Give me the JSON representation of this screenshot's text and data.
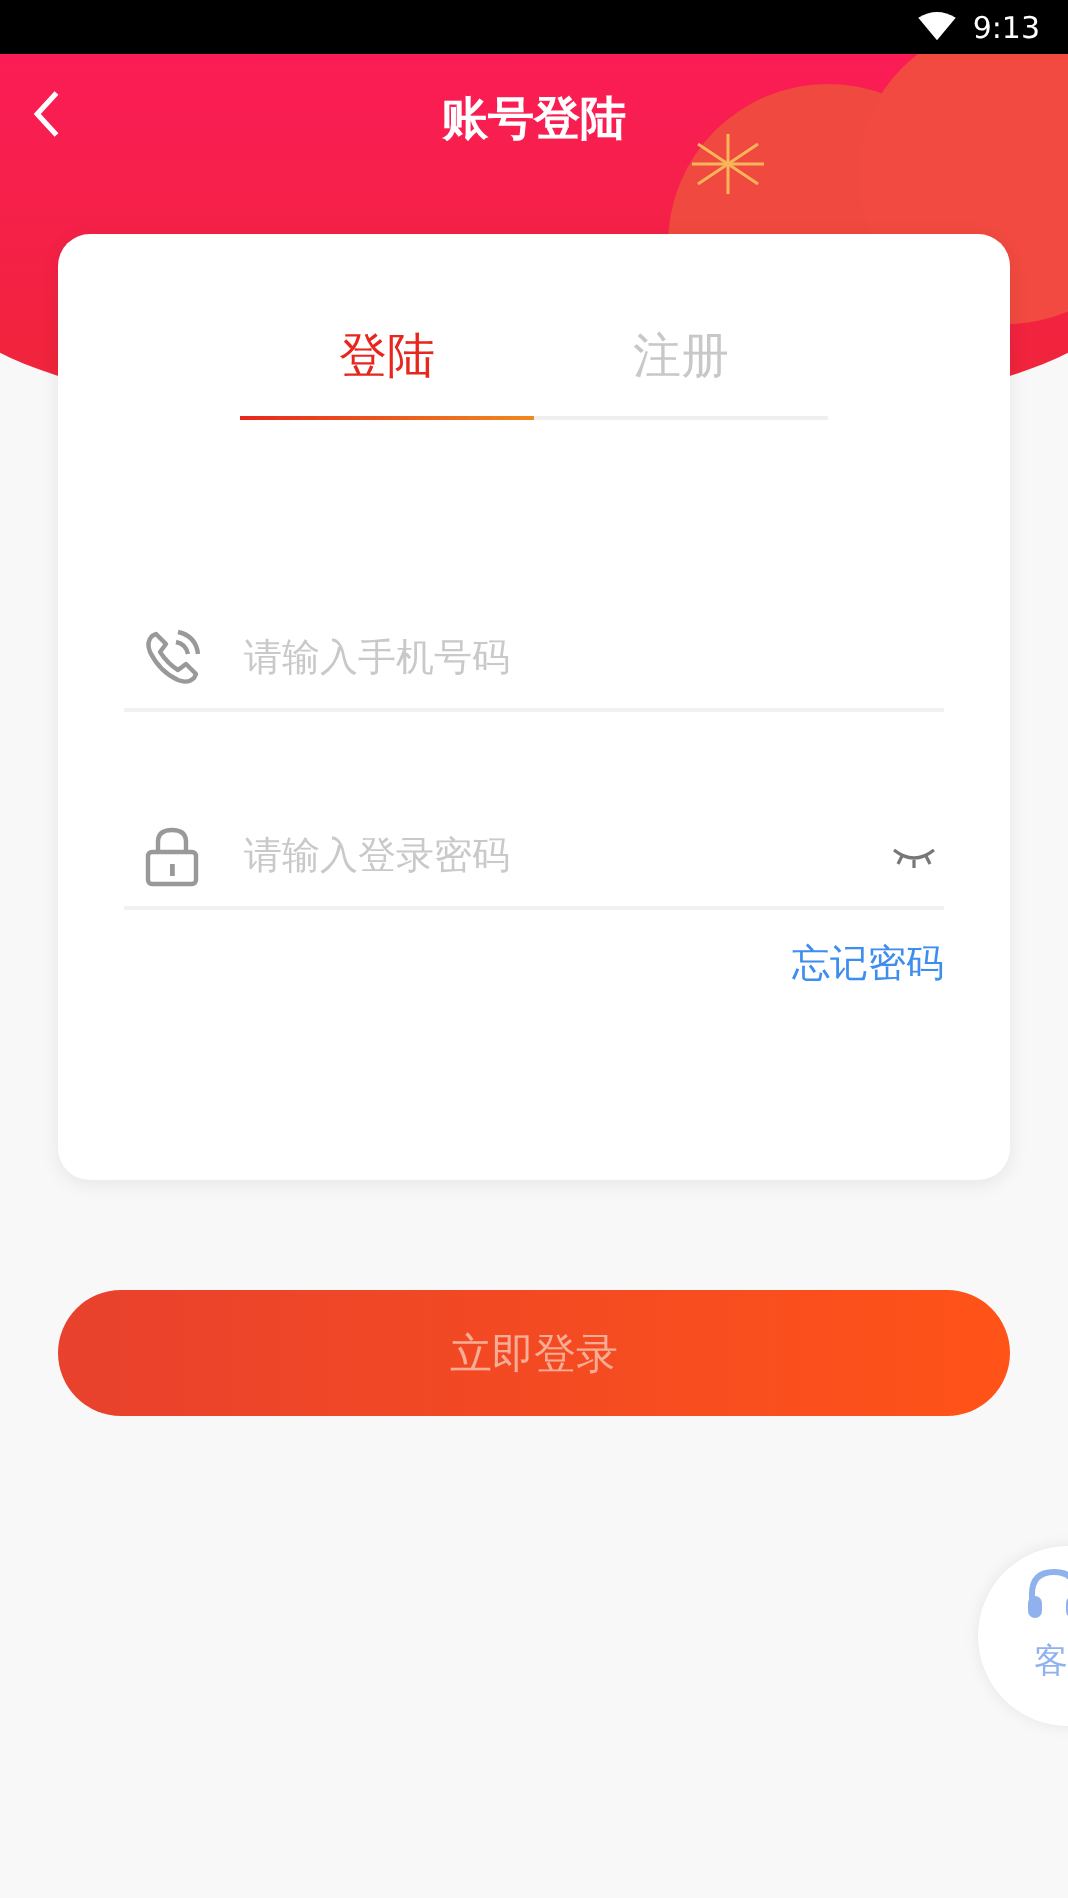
{
  "status_bar": {
    "time": "9:13"
  },
  "header": {
    "title": "账号登陆"
  },
  "tabs": [
    {
      "label": "登陆",
      "selected": true
    },
    {
      "label": "注册",
      "selected": false
    }
  ],
  "fields": [
    {
      "kind": "phone",
      "placeholder": "请输入手机号码"
    },
    {
      "kind": "password",
      "placeholder": "请输入登录密码"
    }
  ],
  "forgot_link": "忘记密码",
  "login_button": "立即登录",
  "service_button": {
    "label": "客"
  }
}
